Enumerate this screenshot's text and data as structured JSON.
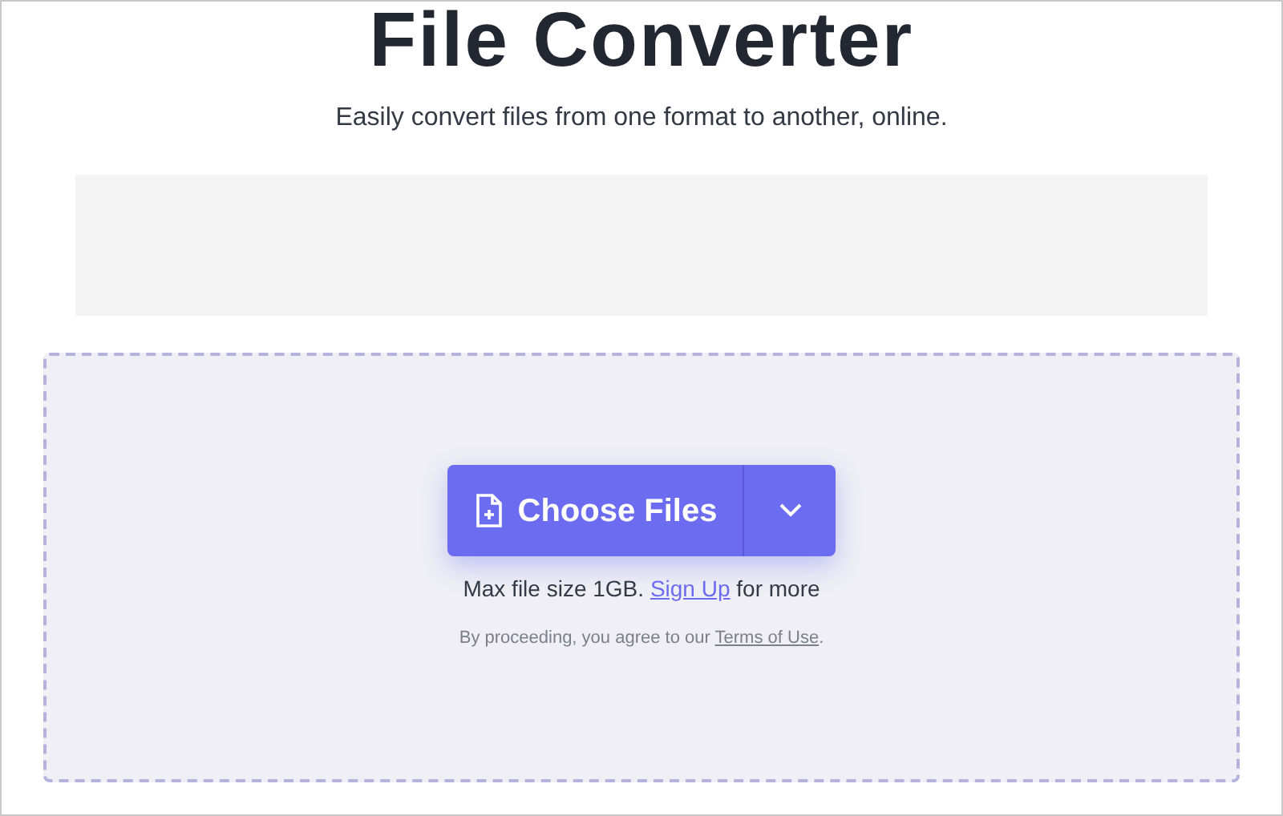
{
  "title": "File Converter",
  "subtitle": "Easily convert files from one format to another, online.",
  "upload": {
    "button": "Choose Files",
    "limit": {
      "text": "Max file size 1GB.",
      "link": "Sign Up",
      "after": "for more"
    },
    "terms": {
      "text": "By proceeding, you agree to our",
      "link": "Terms of Use",
      "after": "."
    }
  }
}
